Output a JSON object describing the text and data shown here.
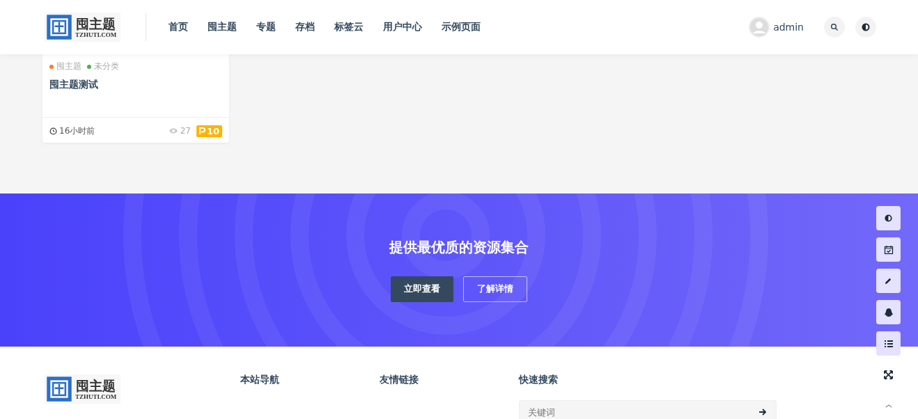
{
  "header": {
    "logo": {
      "title": "囤主题",
      "domain": "TZHUTI.COM"
    },
    "nav": [
      "首页",
      "囤主题",
      "专题",
      "存档",
      "标签云",
      "用户中心",
      "示例页面"
    ],
    "user": {
      "name": "admin"
    }
  },
  "card": {
    "tags": [
      {
        "label": "囤主题",
        "color": "#ff7a29"
      },
      {
        "label": "未分类",
        "color": "#4caf50"
      }
    ],
    "title": "囤主题测试",
    "time": "16小时前",
    "views": "27",
    "points": "10"
  },
  "banner": {
    "title": "提供最优质的资源集合",
    "buttons": [
      "立即查看",
      "了解详情"
    ]
  },
  "footer": {
    "logo": {
      "title": "囤主题",
      "domain": "TZHUTI.COM"
    },
    "columns": [
      "本站导航",
      "友情链接",
      "快速搜索"
    ],
    "search": {
      "placeholder": "关键词"
    }
  }
}
